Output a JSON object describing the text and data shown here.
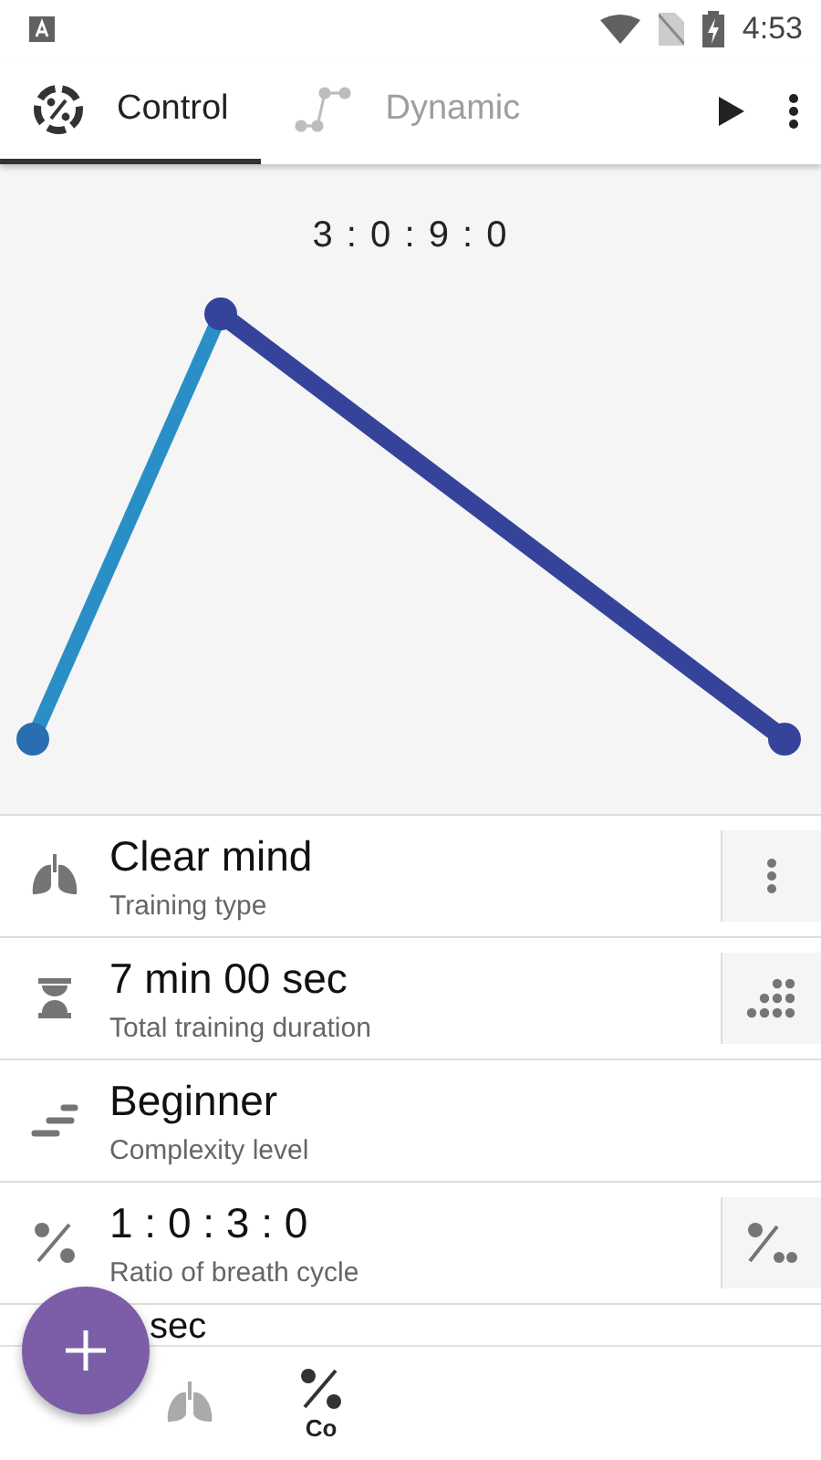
{
  "status_bar": {
    "time": "4:53"
  },
  "tabs": [
    {
      "label": "Control",
      "selected": true,
      "kind": "ratio"
    },
    {
      "label": "Dynamic",
      "selected": false,
      "kind": "graph"
    }
  ],
  "chart": {
    "title": "3 : 0 : 9 : 0"
  },
  "settings": [
    {
      "kind": "lungs",
      "value": "Clear mind",
      "label": "Training type",
      "action": {
        "kind": "more"
      }
    },
    {
      "kind": "hourglass",
      "value": "7 min 00 sec",
      "label": "Total training duration",
      "action": {
        "kind": "dots"
      }
    },
    {
      "kind": "steps",
      "value": "Beginner",
      "label": "Complexity level"
    },
    {
      "kind": "ratio",
      "value": "1 : 0 : 3 : 0",
      "label": "Ratio of breath cycle",
      "action": {
        "kind": "ratio"
      }
    },
    {
      "kind": "none",
      "value": "sec"
    }
  ],
  "bottom_nav": [
    {
      "kind": "lungs",
      "selected": false
    },
    {
      "kind": "ratio",
      "label": "Co",
      "selected": true
    }
  ]
}
